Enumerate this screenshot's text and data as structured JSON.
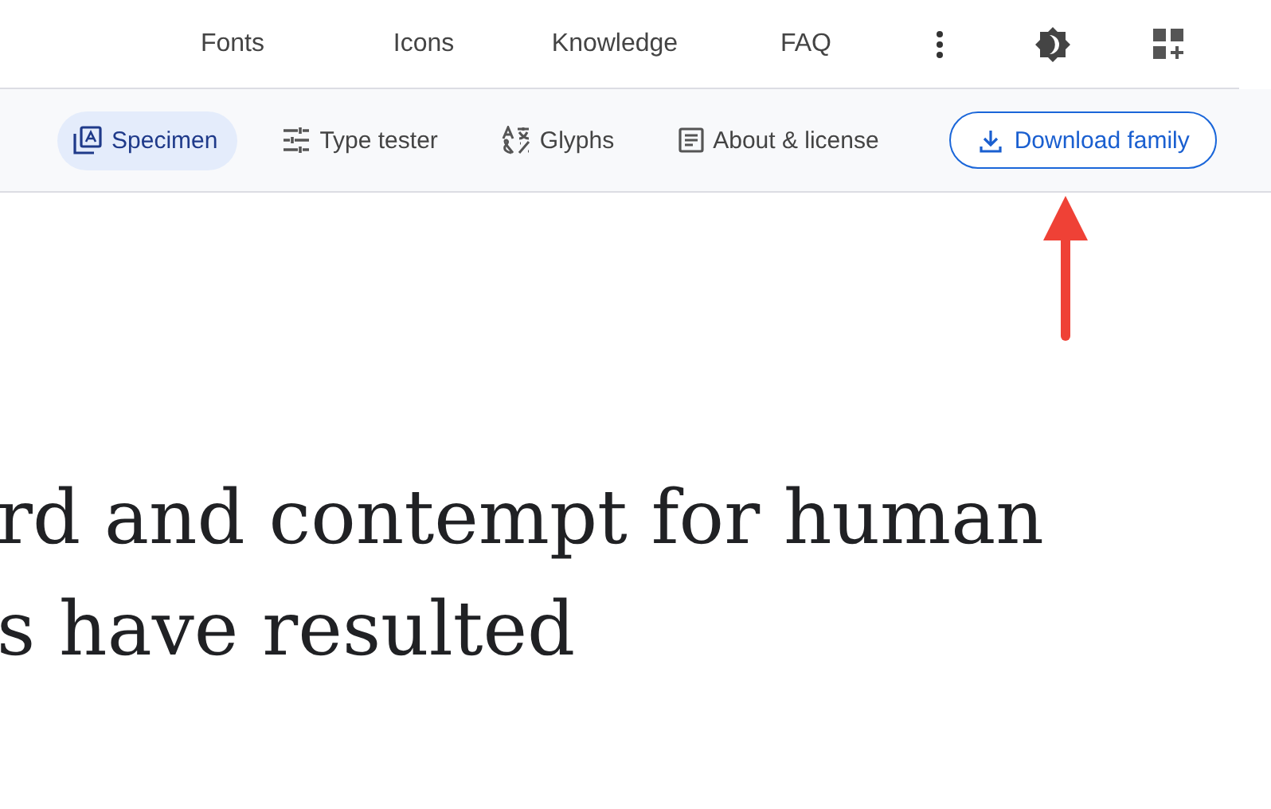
{
  "nav": {
    "links": [
      "Fonts",
      "Icons",
      "Knowledge",
      "FAQ"
    ]
  },
  "tabs": [
    {
      "label": "Specimen",
      "kind": "specimen",
      "selected": true
    },
    {
      "label": "Type tester",
      "kind": "tester",
      "selected": false
    },
    {
      "label": "Glyphs",
      "kind": "glyphs",
      "selected": false
    },
    {
      "label": "About & license",
      "kind": "about",
      "selected": false
    }
  ],
  "download_button": {
    "label": "Download family"
  },
  "specimen_lines": [
    "rd and contempt for human",
    "s have resulted"
  ]
}
